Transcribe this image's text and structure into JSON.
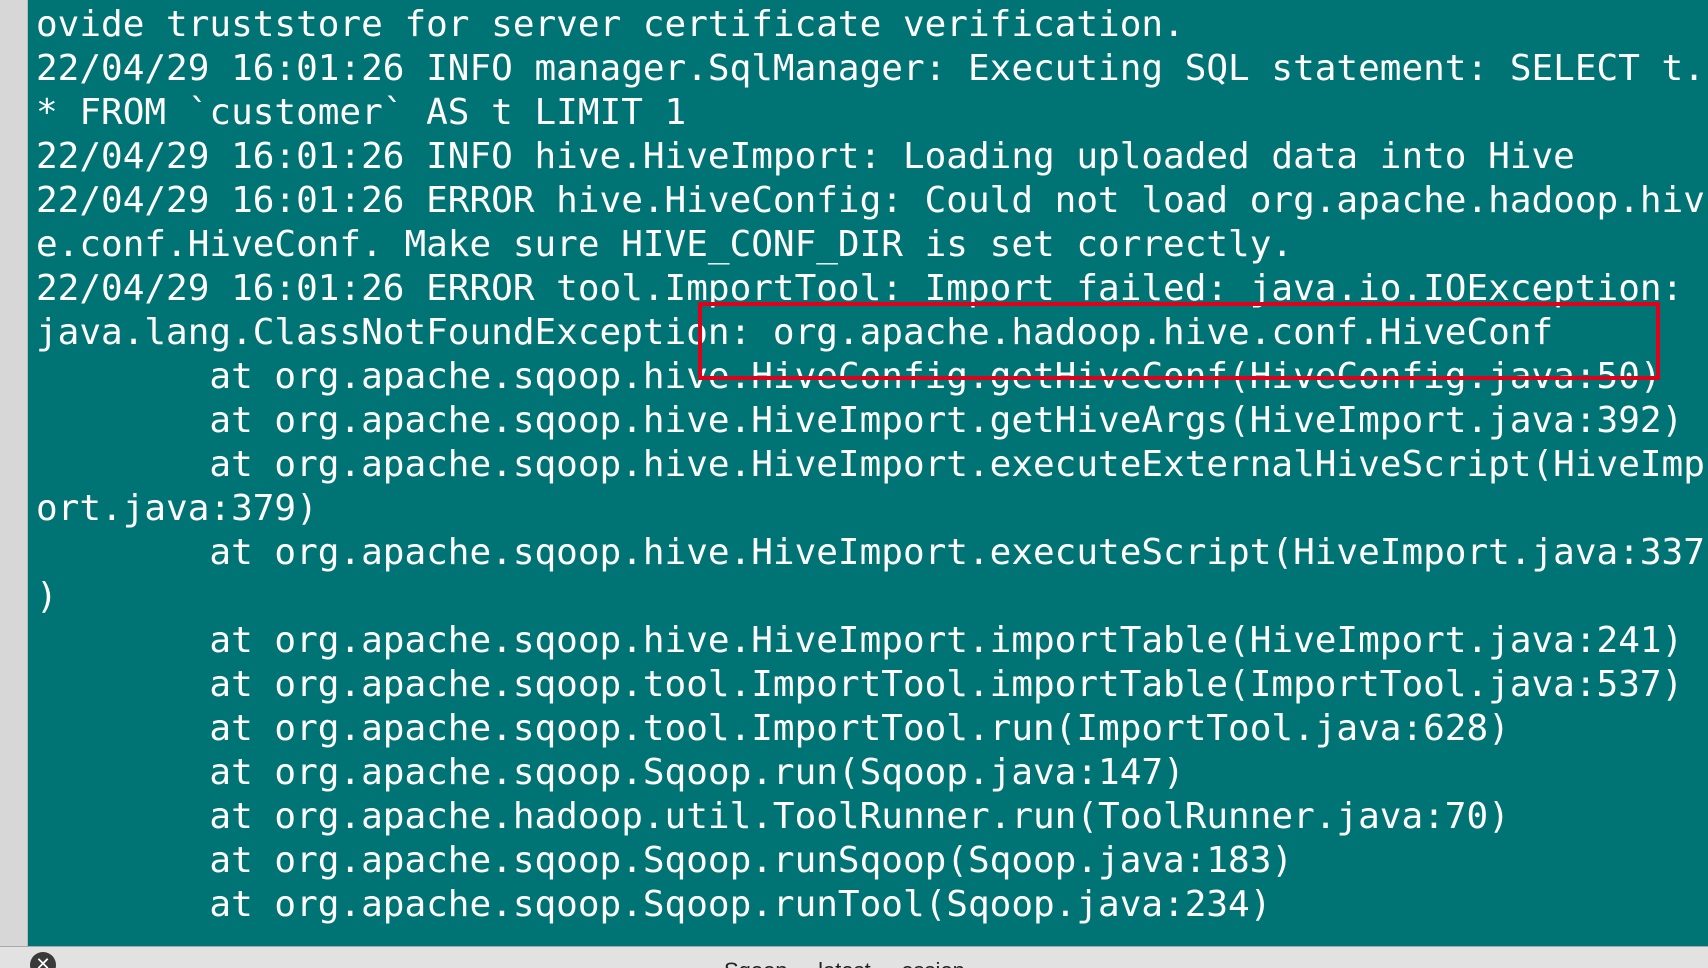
{
  "terminal": {
    "background_color": "#007474",
    "text_color": "#ffffff",
    "lines": [
      "ovide truststore for server certificate verification.",
      "22/04/29 16:01:26 INFO manager.SqlManager: Executing SQL statement: SELECT t.",
      "* FROM `customer` AS t LIMIT 1",
      "22/04/29 16:01:26 INFO hive.HiveImport: Loading uploaded data into Hive",
      "22/04/29 16:01:26 ERROR hive.HiveConfig: Could not load org.apache.hadoop.hiv",
      "e.conf.HiveConf. Make sure HIVE_CONF_DIR is set correctly.",
      "22/04/29 16:01:26 ERROR tool.ImportTool: Import failed: java.io.IOException:",
      "java.lang.ClassNotFoundException: org.apache.hadoop.hive.conf.HiveConf",
      "        at org.apache.sqoop.hive.HiveConfig.getHiveConf(HiveConfig.java:50)",
      "        at org.apache.sqoop.hive.HiveImport.getHiveArgs(HiveImport.java:392)",
      "        at org.apache.sqoop.hive.HiveImport.executeExternalHiveScript(HiveImp",
      "ort.java:379)",
      "        at org.apache.sqoop.hive.HiveImport.executeScript(HiveImport.java:337",
      ")",
      "        at org.apache.sqoop.hive.HiveImport.importTable(HiveImport.java:241)",
      "        at org.apache.sqoop.tool.ImportTool.importTable(ImportTool.java:537)",
      "        at org.apache.sqoop.tool.ImportTool.run(ImportTool.java:628)",
      "        at org.apache.sqoop.Sqoop.run(Sqoop.java:147)",
      "        at org.apache.hadoop.util.ToolRunner.run(ToolRunner.java:70)",
      "        at org.apache.sqoop.Sqoop.runSqoop(Sqoop.java:183)",
      "        at org.apache.sqoop.Sqoop.runTool(Sqoop.java:234)"
    ]
  },
  "annotation": {
    "highlight_color": "#e0001a"
  },
  "statusbar": {
    "close_icon": "close-icon",
    "text": "Sqoop ... latest ... ession"
  }
}
